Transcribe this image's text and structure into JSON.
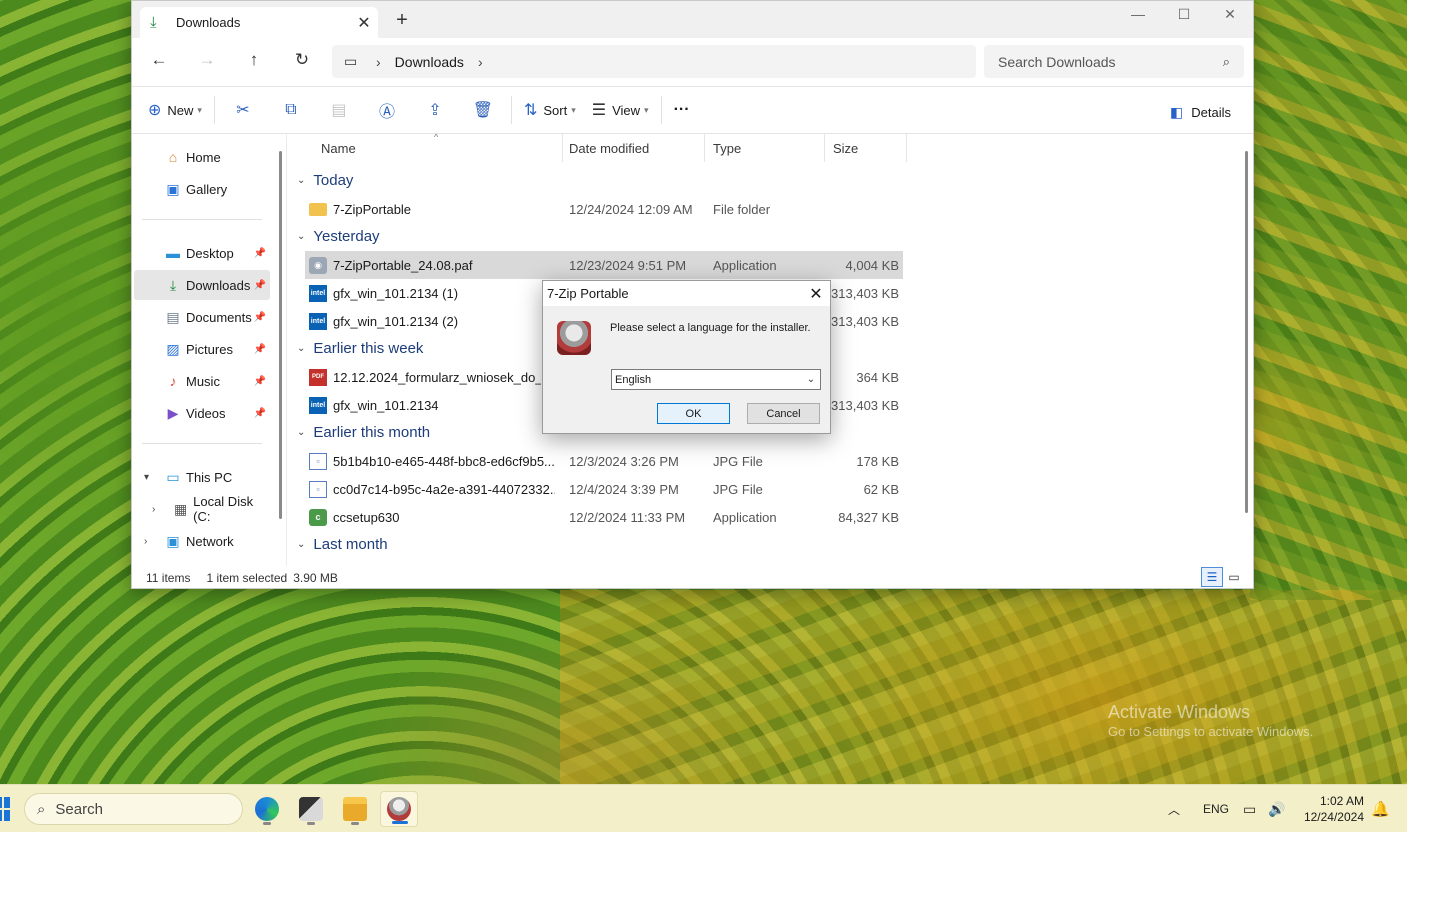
{
  "window": {
    "tab_title": "Downloads",
    "new_tab": "+",
    "controls": {
      "minimize": "—",
      "maximize": "☐",
      "close": "✕"
    }
  },
  "address": {
    "breadcrumb": "Downloads",
    "search_placeholder": "Search Downloads"
  },
  "toolbar": {
    "new_label": "New",
    "sort_label": "Sort",
    "view_label": "View",
    "more_label": "···",
    "details_label": "Details"
  },
  "sidebar": {
    "quick": [
      {
        "label": "Home",
        "icon": "home-icon"
      },
      {
        "label": "Gallery",
        "icon": "gallery-icon"
      }
    ],
    "pinned": [
      {
        "label": "Desktop",
        "icon": "desktop-icon"
      },
      {
        "label": "Downloads",
        "icon": "download-icon",
        "selected": true
      },
      {
        "label": "Documents",
        "icon": "documents-icon"
      },
      {
        "label": "Pictures",
        "icon": "pictures-icon"
      },
      {
        "label": "Music",
        "icon": "music-icon"
      },
      {
        "label": "Videos",
        "icon": "videos-icon"
      }
    ],
    "tree": [
      {
        "label": "This PC",
        "icon": "computer-icon"
      },
      {
        "label": "Local Disk (C:",
        "icon": "disk-icon"
      },
      {
        "label": "Network",
        "icon": "network-icon"
      }
    ]
  },
  "columns": {
    "name": "Name",
    "date": "Date modified",
    "type": "Type",
    "size": "Size"
  },
  "groups": {
    "today": "Today",
    "yesterday": "Yesterday",
    "week": "Earlier this week",
    "month": "Earlier this month",
    "last_month": "Last month"
  },
  "files": [
    {
      "name": "7-ZipPortable",
      "date": "12/24/2024 12:09 AM",
      "type": "File folder",
      "size": "",
      "icon": "folder-icon"
    },
    {
      "name": "7-ZipPortable_24.08.paf",
      "date": "12/23/2024 9:51 PM",
      "type": "Application",
      "size": "4,004 KB",
      "icon": "installer-icon"
    },
    {
      "name": "gfx_win_101.2134 (1)",
      "date": "",
      "type": "",
      "size": "313,403 KB",
      "icon": "intel-icon"
    },
    {
      "name": "gfx_win_101.2134 (2)",
      "date": "",
      "type": "",
      "size": "313,403 KB",
      "icon": "intel-icon"
    },
    {
      "name": "12.12.2024_formularz_wniosek_do_RP",
      "date": "",
      "type": "",
      "size": "364 KB",
      "icon": "pdf-icon"
    },
    {
      "name": "gfx_win_101.2134",
      "date": "",
      "type": "",
      "size": "313,403 KB",
      "icon": "intel-icon"
    },
    {
      "name": "5b1b4b10-e465-448f-bbc8-ed6cf9b5...",
      "date": "12/3/2024 3:26 PM",
      "type": "JPG File",
      "size": "178 KB",
      "icon": "image-file-icon"
    },
    {
      "name": "cc0d7c14-b95c-4a2e-a391-44072332...",
      "date": "12/4/2024 3:39 PM",
      "type": "JPG File",
      "size": "62 KB",
      "icon": "image-file-icon"
    },
    {
      "name": "ccsetup630",
      "date": "12/2/2024 11:33 PM",
      "type": "Application",
      "size": "84,327 KB",
      "icon": "ccleaner-icon"
    }
  ],
  "status": {
    "count": "11 items",
    "selected": "1 item selected",
    "size": "3.90 MB"
  },
  "dialog": {
    "title": "7-Zip Portable",
    "message": "Please select a language for the installer.",
    "language": "English",
    "ok": "OK",
    "cancel": "Cancel"
  },
  "taskbar": {
    "search": "Search",
    "lang": "ENG",
    "time": "1:02 AM",
    "date": "12/24/2024"
  },
  "watermark": {
    "line1": "Activate Windows",
    "line2": "Go to Settings to activate Windows."
  }
}
